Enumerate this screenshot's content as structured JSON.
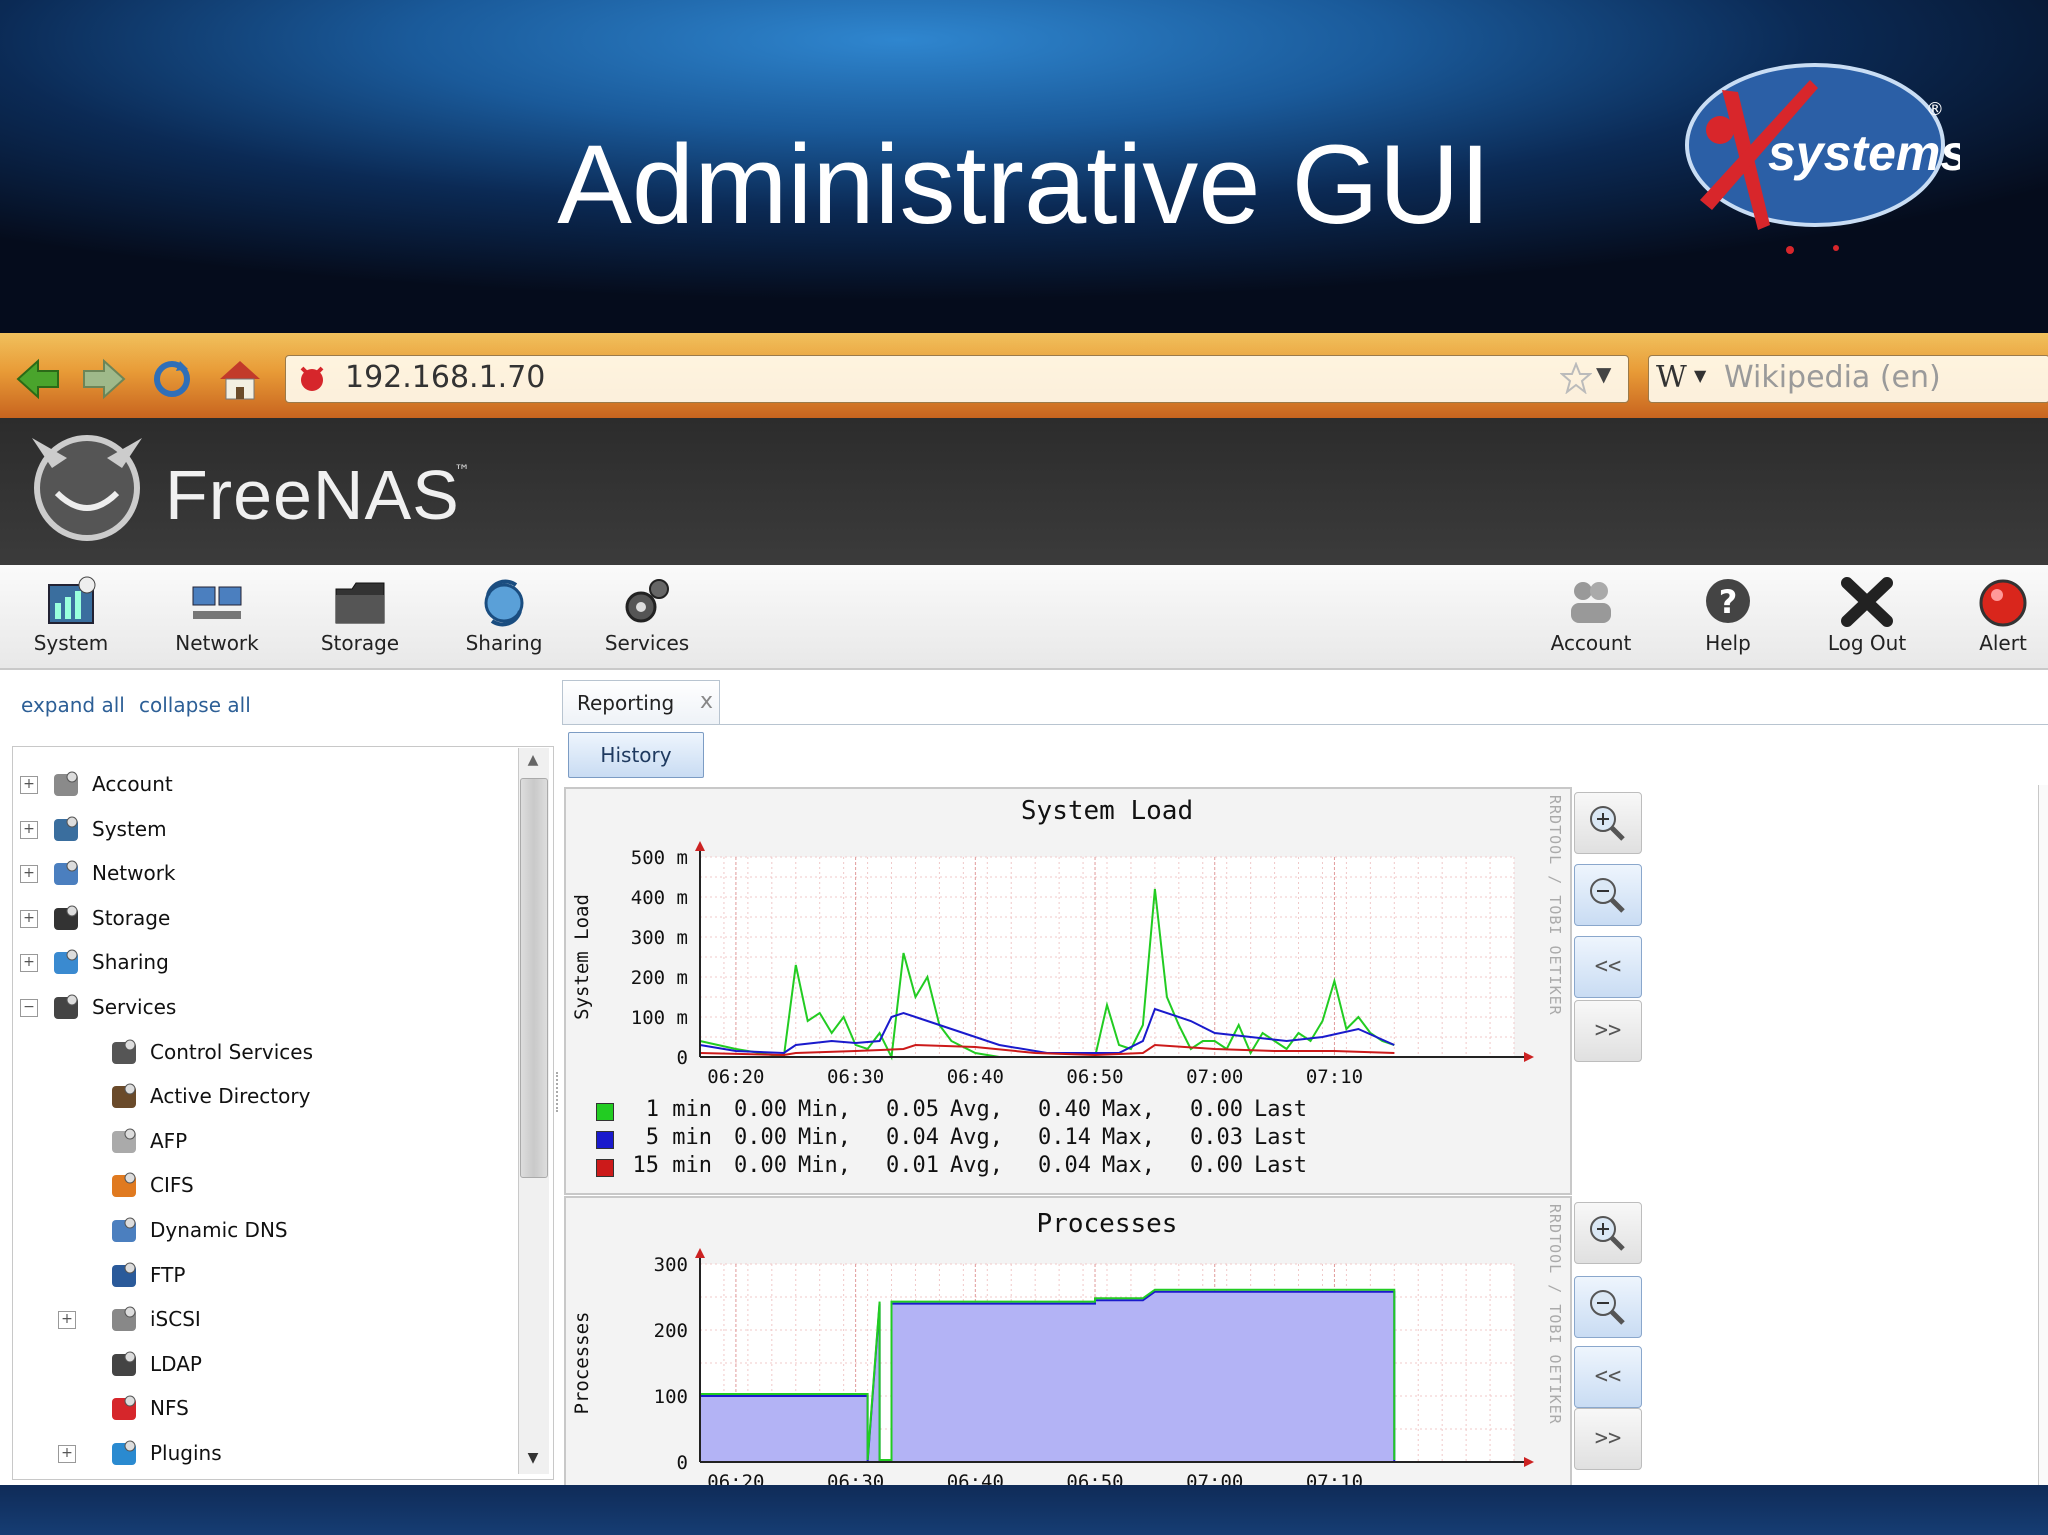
{
  "slide": {
    "title": "Administrative GUI",
    "brand_logo": "systems",
    "brand_mark": "®"
  },
  "browser": {
    "url": "192.168.1.70",
    "search_placeholder": "Wikipedia (en)",
    "search_engine_letter": "W"
  },
  "app": {
    "logo": "FreeNAS",
    "logo_tm": "™"
  },
  "toolbar": {
    "left": [
      {
        "label": "System",
        "icon": "system-icon"
      },
      {
        "label": "Network",
        "icon": "network-icon"
      },
      {
        "label": "Storage",
        "icon": "storage-icon"
      },
      {
        "label": "Sharing",
        "icon": "sharing-icon"
      },
      {
        "label": "Services",
        "icon": "services-icon"
      }
    ],
    "right": [
      {
        "label": "Account",
        "icon": "account-icon"
      },
      {
        "label": "Help",
        "icon": "help-icon"
      },
      {
        "label": "Log Out",
        "icon": "logout-icon"
      },
      {
        "label": "Alert",
        "icon": "alert-icon"
      }
    ]
  },
  "tree": {
    "expand_all": "expand all",
    "collapse_all": "collapse all",
    "items": [
      {
        "label": "Account",
        "level": 0,
        "toggle": "+"
      },
      {
        "label": "System",
        "level": 0,
        "toggle": "+"
      },
      {
        "label": "Network",
        "level": 0,
        "toggle": "+"
      },
      {
        "label": "Storage",
        "level": 0,
        "toggle": "+"
      },
      {
        "label": "Sharing",
        "level": 0,
        "toggle": "+"
      },
      {
        "label": "Services",
        "level": 0,
        "toggle": "−"
      },
      {
        "label": "Control Services",
        "level": 1,
        "toggle": ""
      },
      {
        "label": "Active Directory",
        "level": 1,
        "toggle": ""
      },
      {
        "label": "AFP",
        "level": 1,
        "toggle": ""
      },
      {
        "label": "CIFS",
        "level": 1,
        "toggle": ""
      },
      {
        "label": "Dynamic DNS",
        "level": 1,
        "toggle": ""
      },
      {
        "label": "FTP",
        "level": 1,
        "toggle": ""
      },
      {
        "label": "iSCSI",
        "level": 1,
        "toggle": "+"
      },
      {
        "label": "LDAP",
        "level": 1,
        "toggle": ""
      },
      {
        "label": "NFS",
        "level": 1,
        "toggle": ""
      },
      {
        "label": "Plugins",
        "level": 1,
        "toggle": "+"
      }
    ]
  },
  "tabs": {
    "reporting": "Reporting",
    "close": "x",
    "history": "History"
  },
  "graph_controls": {
    "zoom_in": "zoom-in-icon",
    "zoom_out": "zoom-out-icon",
    "back": "<<",
    "forward": ">>"
  },
  "rrd_credit": "RRDTOOL / TOBI OETIKER",
  "chart_data": [
    {
      "type": "line",
      "title": "System Load",
      "ylabel": "System Load",
      "xlabel": "",
      "x_ticks": [
        "06:20",
        "06:30",
        "06:40",
        "06:50",
        "07:00",
        "07:10"
      ],
      "x_range": [
        "06:17",
        "07:25"
      ],
      "ylim": [
        0,
        500
      ],
      "y_ticks": [
        0,
        100,
        200,
        300,
        400,
        500
      ],
      "y_tick_labels": [
        "0",
        "100 m",
        "200 m",
        "300 m",
        "400 m",
        "500 m"
      ],
      "grid": true,
      "series": [
        {
          "name": "1 min",
          "color": "#22cc22",
          "x": [
            "06:17",
            "06:20",
            "06:24",
            "06:25",
            "06:26",
            "06:27",
            "06:28",
            "06:29",
            "06:30",
            "06:31",
            "06:32",
            "06:33",
            "06:34",
            "06:35",
            "06:36",
            "06:37",
            "06:38",
            "06:40",
            "06:42",
            "06:44",
            "06:46",
            "06:48",
            "06:50",
            "06:51",
            "06:52",
            "06:53",
            "06:54",
            "06:55",
            "06:56",
            "06:57",
            "06:58",
            "06:59",
            "07:00",
            "07:01",
            "07:02",
            "07:03",
            "07:04",
            "07:05",
            "07:06",
            "07:07",
            "07:08",
            "07:09",
            "07:10",
            "07:11",
            "07:12",
            "07:13",
            "07:14",
            "07:15"
          ],
          "values": [
            40,
            20,
            0,
            230,
            90,
            110,
            60,
            100,
            30,
            20,
            60,
            0,
            260,
            150,
            200,
            80,
            40,
            10,
            0,
            0,
            0,
            0,
            0,
            130,
            30,
            20,
            80,
            420,
            150,
            80,
            20,
            40,
            40,
            20,
            80,
            10,
            60,
            40,
            20,
            60,
            40,
            90,
            190,
            70,
            100,
            60,
            40,
            30
          ]
        },
        {
          "name": "5 min",
          "color": "#1a1acc",
          "x": [
            "06:17",
            "06:20",
            "06:24",
            "06:25",
            "06:28",
            "06:30",
            "06:32",
            "06:33",
            "06:34",
            "06:35",
            "06:38",
            "06:42",
            "06:46",
            "06:50",
            "06:52",
            "06:54",
            "06:55",
            "06:58",
            "07:00",
            "07:03",
            "07:06",
            "07:09",
            "07:12",
            "07:15"
          ],
          "values": [
            30,
            15,
            10,
            30,
            40,
            35,
            40,
            100,
            110,
            100,
            70,
            30,
            10,
            10,
            10,
            40,
            120,
            90,
            60,
            50,
            40,
            50,
            70,
            30
          ]
        },
        {
          "name": "15 min",
          "color": "#cc1a1a",
          "x": [
            "06:17",
            "06:24",
            "06:25",
            "06:30",
            "06:34",
            "06:35",
            "06:40",
            "06:45",
            "06:50",
            "06:54",
            "06:55",
            "07:00",
            "07:05",
            "07:10",
            "07:15"
          ],
          "values": [
            10,
            5,
            10,
            15,
            20,
            30,
            25,
            10,
            5,
            10,
            30,
            20,
            15,
            15,
            10
          ]
        }
      ],
      "legend": [
        {
          "name": "1 min",
          "min": "0.00",
          "avg": "0.05",
          "max": "0.40",
          "last": "0.00",
          "color": "#22cc22"
        },
        {
          "name": "5 min",
          "min": "0.00",
          "avg": "0.04",
          "max": "0.14",
          "last": "0.03",
          "color": "#1a1acc"
        },
        {
          "name": "15 min",
          "min": "0.00",
          "avg": "0.01",
          "max": "0.04",
          "last": "0.00",
          "color": "#cc1a1a"
        }
      ],
      "legend_labels": {
        "min": "Min,",
        "avg": "Avg,",
        "max": "Max,",
        "last": "Last"
      }
    },
    {
      "type": "area",
      "title": "Processes",
      "ylabel": "Processes",
      "xlabel": "",
      "x_ticks": [
        "06:20",
        "06:30",
        "06:40",
        "06:50",
        "07:00",
        "07:10"
      ],
      "x_range": [
        "06:17",
        "07:25"
      ],
      "ylim": [
        0,
        300
      ],
      "y_ticks": [
        0,
        100,
        200,
        300
      ],
      "grid": true,
      "series": [
        {
          "name": "",
          "color": "#b3b3f5",
          "x": [
            "06:17",
            "06:31",
            "06:31",
            "06:32",
            "06:32",
            "06:33",
            "06:33",
            "06:50",
            "06:50",
            "06:54",
            "06:55",
            "07:15",
            "07:15"
          ],
          "values": [
            100,
            100,
            0,
            240,
            0,
            0,
            240,
            240,
            245,
            245,
            258,
            258,
            0
          ]
        }
      ]
    }
  ]
}
